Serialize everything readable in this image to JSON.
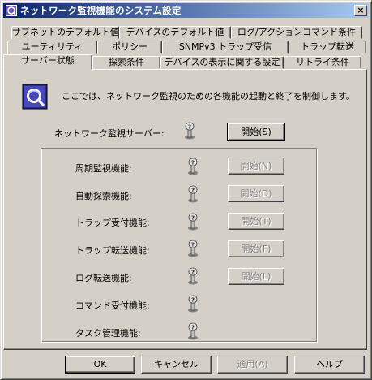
{
  "window": {
    "title": "ネットワーク監視機能のシステム設定",
    "close_label": "×"
  },
  "tabs": {
    "row1": [
      {
        "label": "サブネットのデフォルト値"
      },
      {
        "label": "デバイスのデフォルト値"
      },
      {
        "label": "ログ/アクションコマンド条件"
      }
    ],
    "row2": [
      {
        "label": "ユーティリティ"
      },
      {
        "label": "ポリシー"
      },
      {
        "label": "SNMPv3 トラップ受信"
      },
      {
        "label": "トラップ転送"
      }
    ],
    "row3": [
      {
        "label": "サーバー状態",
        "active": true
      },
      {
        "label": "探索条件"
      },
      {
        "label": "デバイスの表示に関する設定"
      },
      {
        "label": "リトライ条件"
      }
    ]
  },
  "panel": {
    "description": "ここでは、ネットワーク監視のための各機能の起動と終了を制御します。",
    "server": {
      "label": "ネットワーク監視サーバー:",
      "button": "開始(S)"
    },
    "functions": [
      {
        "label": "周期監視機能:",
        "button": "開始(N)"
      },
      {
        "label": "自動探索機能:",
        "button": "開始(D)"
      },
      {
        "label": "トラップ受付機能:",
        "button": "開始(T)"
      },
      {
        "label": "トラップ転送機能:",
        "button": "開始(F)"
      },
      {
        "label": "ログ転送機能:",
        "button": "開始(L)"
      },
      {
        "label": "コマンド受付機能:"
      },
      {
        "label": "タスク管理機能:"
      }
    ]
  },
  "footer": {
    "ok": "OK",
    "cancel": "キャンセル",
    "apply": "適用(A)",
    "help": "ヘルプ"
  },
  "colors": {
    "title_start": "#0a246a",
    "title_end": "#a6caf0",
    "face": "#d4d0c8"
  }
}
